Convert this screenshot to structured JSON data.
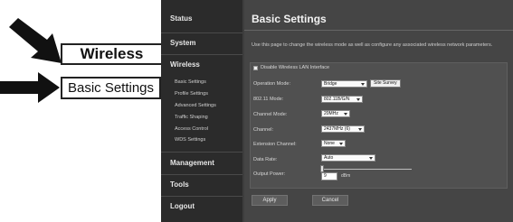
{
  "callouts": {
    "wireless": "Wireless",
    "basic_settings": "Basic Settings"
  },
  "sidebar": {
    "main": [
      {
        "label": "Status"
      },
      {
        "label": "System"
      },
      {
        "label": "Wireless"
      },
      {
        "label": "Management"
      },
      {
        "label": "Tools"
      },
      {
        "label": "Logout"
      }
    ],
    "sub": [
      {
        "label": "Basic Settings"
      },
      {
        "label": "Profile Settings"
      },
      {
        "label": "Advanced Settings"
      },
      {
        "label": "Traffic Shaping"
      },
      {
        "label": "Access Control"
      },
      {
        "label": "WDS Settings"
      }
    ]
  },
  "page": {
    "title": "Basic Settings",
    "description": "Use this page to change the wireless mode as well as configure any associated wireless network parameters."
  },
  "form": {
    "disable_label": "Disable Wireless LAN Interface",
    "rows": [
      {
        "label": "Operation Mode:",
        "value": "Bridge"
      },
      {
        "label": "802.11 Mode:",
        "value": "802.11B/G/N"
      },
      {
        "label": "Channel Mode:",
        "value": "20MHz"
      },
      {
        "label": "Channel:",
        "value": "2437MHz (6)"
      },
      {
        "label": "Extension Channel:",
        "value": "None"
      },
      {
        "label": "Data Rate:",
        "value": "Auto"
      }
    ],
    "site_survey": "Site Survey",
    "output_power_label": "Output Power:",
    "output_power_value": "9",
    "output_power_unit": "dBm",
    "slider_level": 0.0
  },
  "buttons": {
    "apply": "Apply",
    "cancel": "Cancel"
  }
}
